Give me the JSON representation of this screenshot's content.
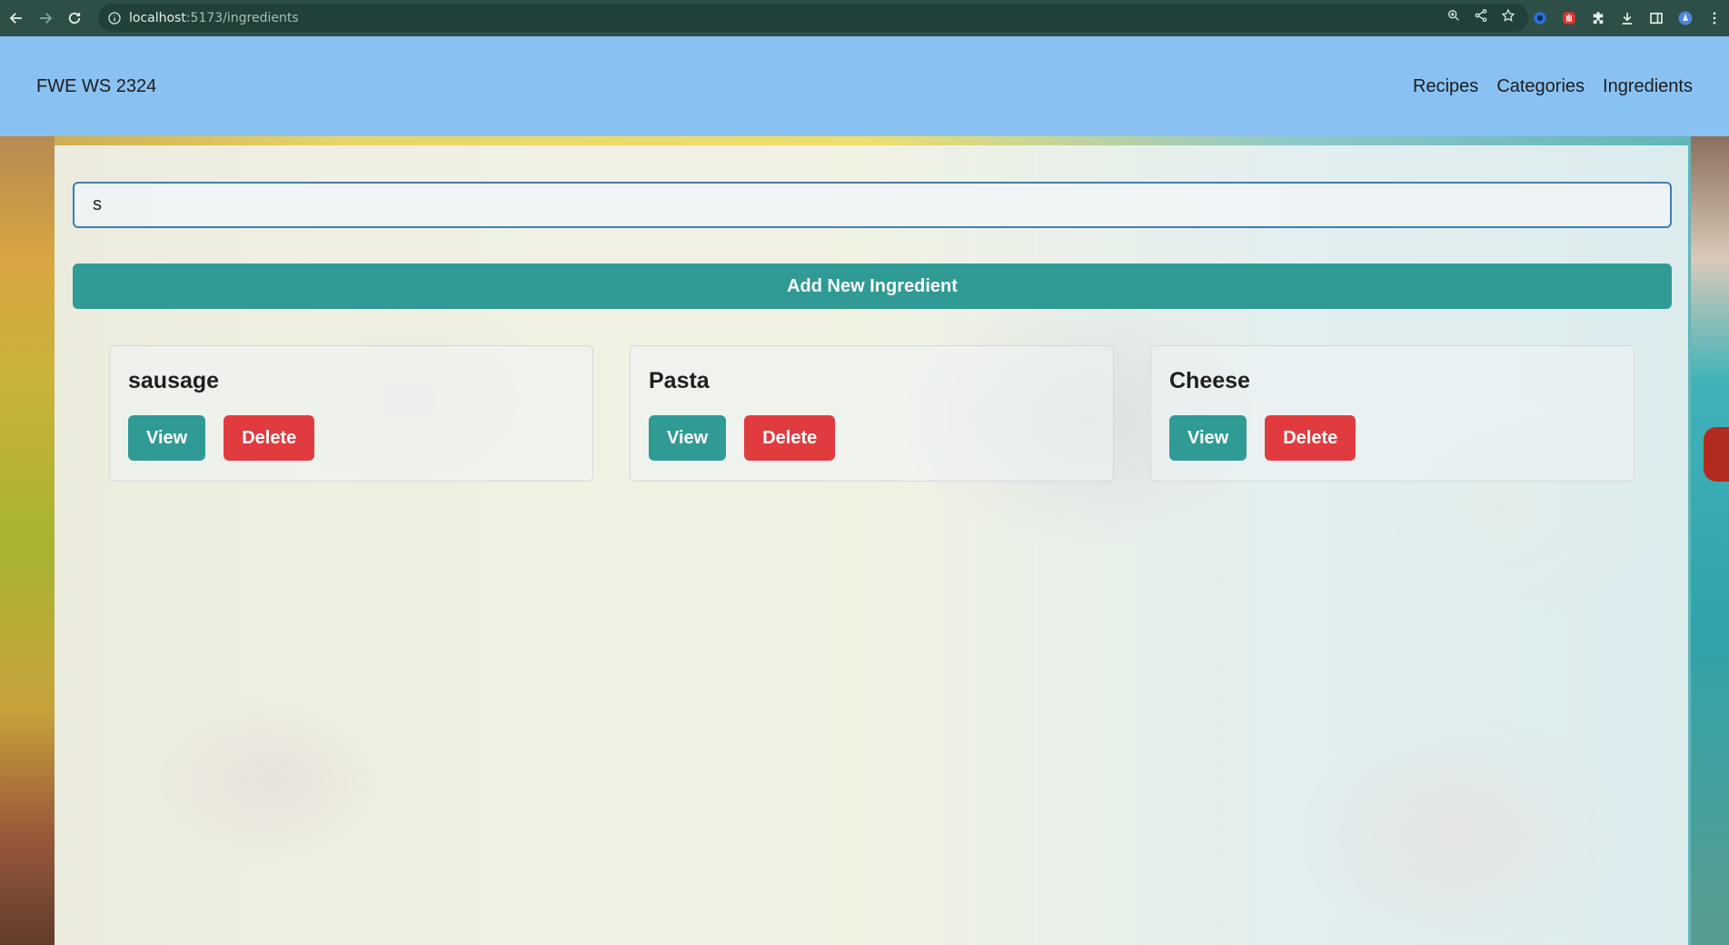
{
  "browser": {
    "url_host": "localhost",
    "url_path": ":5173/ingredients"
  },
  "header": {
    "brand": "FWE WS 2324",
    "nav": [
      {
        "label": "Recipes"
      },
      {
        "label": "Categories"
      },
      {
        "label": "Ingredients"
      }
    ]
  },
  "search": {
    "value": "s",
    "placeholder": ""
  },
  "add_button": {
    "label": "Add New Ingredient"
  },
  "ingredients": [
    {
      "name": "sausage",
      "view_label": "View",
      "delete_label": "Delete"
    },
    {
      "name": "Pasta",
      "view_label": "View",
      "delete_label": "Delete"
    },
    {
      "name": "Cheese",
      "view_label": "View",
      "delete_label": "Delete"
    }
  ],
  "colors": {
    "header_bg": "#89c2f2",
    "primary": "#309a95",
    "danger": "#e03c40"
  },
  "icons": [
    "back-icon",
    "forward-icon",
    "reload-icon",
    "info-icon",
    "zoom-icon",
    "share-icon",
    "star-icon",
    "extension-icon",
    "download-icon",
    "sidebar-icon",
    "profile-icon",
    "menu-icon"
  ]
}
